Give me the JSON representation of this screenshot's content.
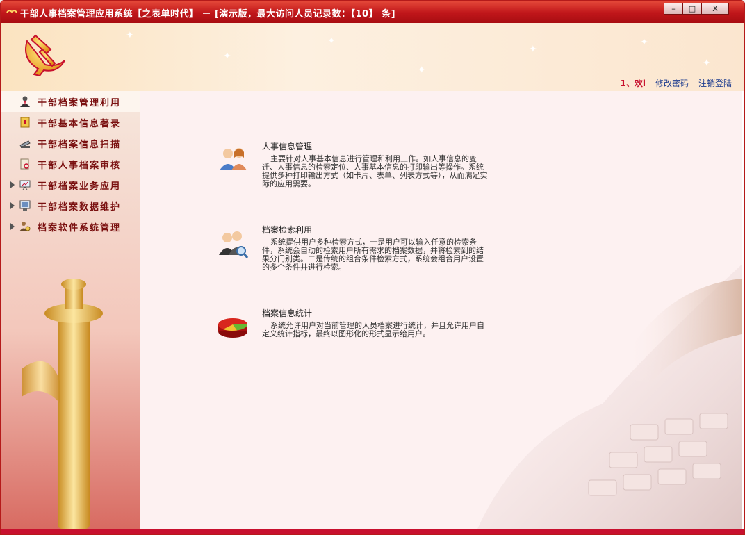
{
  "window": {
    "title": "干部人事档案管理应用系统【之表单时代】 － [演示版，最大访问人员记录数：【10】 条]",
    "minimize_label": "–",
    "maximize_label": "□",
    "close_label": "X"
  },
  "header": {
    "welcome": "1、欢i",
    "change_password": "修改密码",
    "logout": "注销登陆"
  },
  "sidebar": {
    "items": [
      {
        "label": "干部档案管理利用",
        "icon": "person-icon",
        "has_arrow": false,
        "active": true
      },
      {
        "label": "干部基本信息著录",
        "icon": "document-icon",
        "has_arrow": false,
        "active": false
      },
      {
        "label": "干部档案信息扫描",
        "icon": "scanner-icon",
        "has_arrow": false,
        "active": false
      },
      {
        "label": "干部人事档案审核",
        "icon": "review-icon",
        "has_arrow": false,
        "active": false
      },
      {
        "label": "干部档案业务应用",
        "icon": "presentation-icon",
        "has_arrow": true,
        "active": false
      },
      {
        "label": "干部档案数据维护",
        "icon": "database-icon",
        "has_arrow": true,
        "active": false
      },
      {
        "label": "档案软件系统管理",
        "icon": "admin-icon",
        "has_arrow": true,
        "active": false
      }
    ]
  },
  "main": {
    "features": [
      {
        "title": "人事信息管理",
        "icon": "users-icon",
        "desc": "主要针对人事基本信息进行管理和利用工作。如人事信息的变迁、人事信息的检索定位、人事基本信息的打印输出等操作。系统提供多种打印输出方式（如卡片、表单、列表方式等），从而满足实际的应用需要。"
      },
      {
        "title": "档案检索利用",
        "icon": "search-users-icon",
        "desc": "系统提供用户多种检索方式，一是用户可以输入任意的检索条件，系统会自动的检索用户所有需求的档案数据，并将检索到的结果分门别类。二是传统的组合条件检索方式，系统会组合用户设置的多个条件并进行检索。"
      },
      {
        "title": "档案信息统计",
        "icon": "pie-chart-icon",
        "desc": "系统允许用户对当前管理的人员档案进行统计，并且允许用户自定义统计指标，最终以图形化的形式显示给用户。"
      }
    ]
  },
  "colors": {
    "title_bar": "#c0161a",
    "menu_text": "#7a1010",
    "link": "#1d3c8f",
    "welcome": "#c8102e"
  }
}
